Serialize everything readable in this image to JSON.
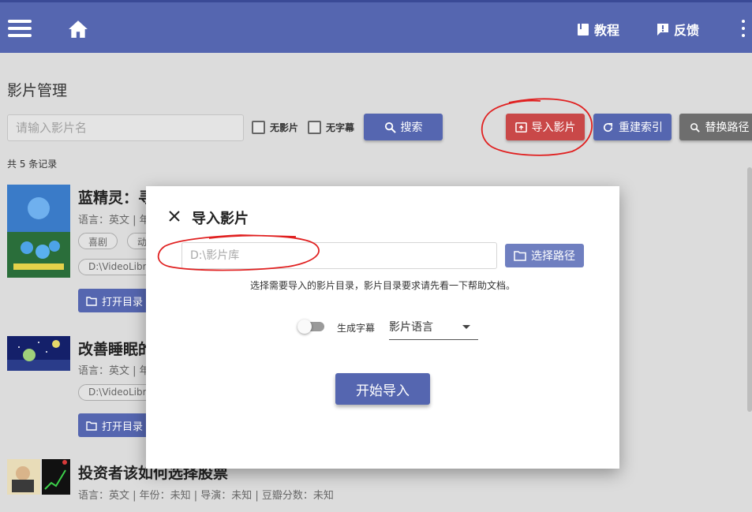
{
  "topbar": {
    "tutorial_label": "教程",
    "feedback_label": "反馈"
  },
  "page": {
    "title": "影片管理",
    "search_placeholder": "请输入影片名",
    "filter_no_movie": "无影片",
    "filter_no_subtitle": "无字幕",
    "search_button": "搜索",
    "import_button": "导入影片",
    "reindex_button": "重建索引",
    "replace_path_button": "替换路径",
    "records_text": "共 5 条记录"
  },
  "movies": [
    {
      "title": "蓝精灵：寻",
      "meta": "语言：英文 | 年",
      "tags": [
        "喜剧",
        "动"
      ],
      "path": "D:\\VideoLibra",
      "open_label": "打开目录"
    },
    {
      "title": "改善睡眠的",
      "meta": "语言：英文 | 年",
      "path": "D:\\VideoLibra",
      "open_label": "打开目录"
    },
    {
      "title": "投资者该如何选择股票",
      "meta": "语言：英文 | 年份：未知 | 导演：未知 | 豆瓣分数：未知"
    }
  ],
  "dialog": {
    "title": "导入影片",
    "path_placeholder": "D:\\影片库",
    "choose_path_button": "选择路径",
    "hint": "选择需要导入的影片目录，影片目录要求请先看一下帮助文档。",
    "generate_subtitle_label": "生成字幕",
    "generate_subtitle_on": false,
    "language_select_value": "影片语言",
    "start_button": "开始导入"
  },
  "colors": {
    "primary": "#5566b0",
    "danger": "#c94848",
    "annotation": "#e02020"
  }
}
